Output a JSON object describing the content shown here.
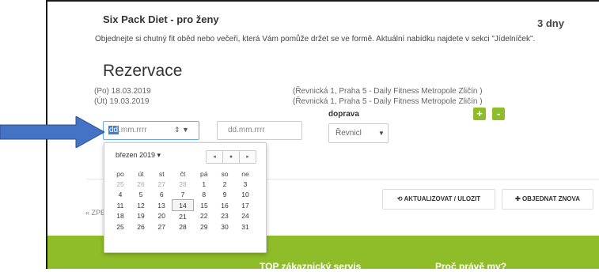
{
  "header": {
    "title": "Six Pack Diet - pro ženy",
    "days": "3 dny",
    "description": "Objednejte si chutný fit oběd nebo večeři, která Vám pomůže držet se ve formě. Aktuální nabídku najdete v sekci \"Jídelníček\"."
  },
  "reservation": {
    "heading": "Rezervace",
    "entries": [
      {
        "date": "(Po) 18.03.2019",
        "location": "(Řevnická 1, Praha 5 - Daily Fitness Metropole Zličín )"
      },
      {
        "date": "(Út) 19.03.2019",
        "location": "(Řevnická 1, Praha 5 - Daily Fitness Metropole Zličín )"
      }
    ],
    "doprava_label": "doprava",
    "plus_label": "+",
    "minus_label": "-"
  },
  "inputs": {
    "date_from_dd": "dd",
    "date_from_rest": ".mm.rrrr",
    "date_from_spin": "⇕ ▼",
    "date_to": "dd.mm.rrrr",
    "transport_value": "Řevnicl",
    "transport_arrow": "▼"
  },
  "calendar": {
    "month": "březen 2019 ▾",
    "nav": [
      "◂",
      "●",
      "▸"
    ],
    "weekdays": [
      "po",
      "út",
      "st",
      "čt",
      "pá",
      "so",
      "ne"
    ],
    "weeks": [
      [
        "25",
        "26",
        "27",
        "28",
        "1",
        "2",
        "3"
      ],
      [
        "4",
        "5",
        "6",
        "7",
        "8",
        "9",
        "10"
      ],
      [
        "11",
        "12",
        "13",
        "14",
        "15",
        "16",
        "17"
      ],
      [
        "18",
        "19",
        "20",
        "21",
        "22",
        "23",
        "24"
      ],
      [
        "25",
        "26",
        "27",
        "28",
        "29",
        "30",
        "31"
      ]
    ],
    "today": "14"
  },
  "actions": {
    "aktualizovat": "⟲ AKTUALIZOVAT / ULOZIT",
    "objednat": "✚ OBJEDNAT ZNOVA",
    "back": "« ZPE"
  },
  "footer": {
    "col1": "TOP zákaznický servis",
    "col2": "Proč právě my?"
  },
  "colors": {
    "accent_green": "#8fbd29",
    "arrow_blue": "#4472c4",
    "focus_blue": "#66aee8"
  }
}
